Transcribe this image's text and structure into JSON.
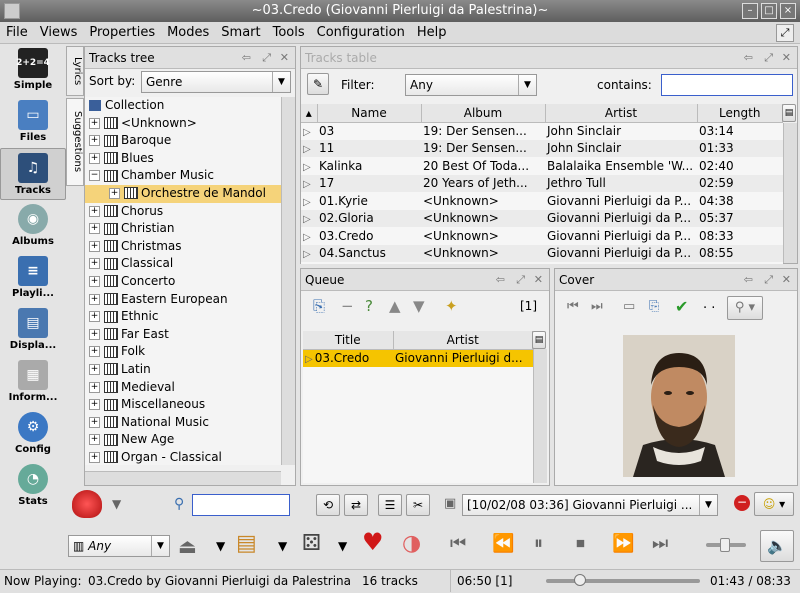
{
  "window": {
    "title": "~03.Credo (Giovanni Pierluigi da Palestrina)~"
  },
  "menu": [
    "File",
    "Views",
    "Properties",
    "Modes",
    "Smart",
    "Tools",
    "Configuration",
    "Help"
  ],
  "nav": [
    {
      "label": "Simple",
      "icon": "simple-mode-icon"
    },
    {
      "label": "Files",
      "icon": "folder-icon"
    },
    {
      "label": "Tracks",
      "icon": "music-note-icon"
    },
    {
      "label": "Albums",
      "icon": "cd-icon"
    },
    {
      "label": "Playli...",
      "icon": "playlist-icon"
    },
    {
      "label": "Displa...",
      "icon": "display-icon"
    },
    {
      "label": "Inform...",
      "icon": "info-icon"
    },
    {
      "label": "Config",
      "icon": "gear-icon"
    },
    {
      "label": "Stats",
      "icon": "pie-chart-icon"
    }
  ],
  "vtabs": [
    "Lyrics",
    "Suggestions"
  ],
  "tracks_tree": {
    "title": "Tracks tree",
    "sort_label": "Sort by:",
    "sort_value": "Genre",
    "root": "Collection",
    "items": [
      {
        "label": "<Unknown>",
        "sign": "+"
      },
      {
        "label": "Baroque",
        "sign": "+"
      },
      {
        "label": "Blues",
        "sign": "+"
      },
      {
        "label": "Chamber Music",
        "sign": "−"
      },
      {
        "label": "Orchestre de Mandol",
        "sign": "+",
        "child": true,
        "selected": true
      },
      {
        "label": "Chorus",
        "sign": "+"
      },
      {
        "label": "Christian",
        "sign": "+"
      },
      {
        "label": "Christmas",
        "sign": "+"
      },
      {
        "label": "Classical",
        "sign": "+"
      },
      {
        "label": "Concerto",
        "sign": "+"
      },
      {
        "label": "Eastern European",
        "sign": "+"
      },
      {
        "label": "Ethnic",
        "sign": "+"
      },
      {
        "label": "Far East",
        "sign": "+"
      },
      {
        "label": "Folk",
        "sign": "+"
      },
      {
        "label": "Latin",
        "sign": "+"
      },
      {
        "label": "Medieval",
        "sign": "+"
      },
      {
        "label": "Miscellaneous",
        "sign": "+"
      },
      {
        "label": "National Music",
        "sign": "+"
      },
      {
        "label": "New Age",
        "sign": "+"
      },
      {
        "label": "Organ - Classical",
        "sign": "+"
      }
    ]
  },
  "tracks_table": {
    "title": "Tracks table",
    "filter_label": "Filter:",
    "filter_value": "Any",
    "contains_label": "contains:",
    "contains_value": "",
    "columns": [
      "Name",
      "Album",
      "Artist",
      "Length"
    ],
    "rows": [
      [
        "03",
        "19: Der Sensen...",
        "John Sinclair",
        "03:14"
      ],
      [
        "11",
        "19: Der Sensen...",
        "John Sinclair",
        "01:33"
      ],
      [
        "Kalinka",
        "20 Best Of Toda...",
        "Balalaika Ensemble 'W...",
        "02:40"
      ],
      [
        "17",
        "20 Years of Jeth...",
        "Jethro Tull",
        "02:59"
      ],
      [
        "01.Kyrie",
        "<Unknown>",
        "Giovanni Pierluigi da P...",
        "04:38"
      ],
      [
        "02.Gloria",
        "<Unknown>",
        "Giovanni Pierluigi da P...",
        "05:37"
      ],
      [
        "03.Credo",
        "<Unknown>",
        "Giovanni Pierluigi da P...",
        "08:33"
      ],
      [
        "04.Sanctus",
        "<Unknown>",
        "Giovanni Pierluigi da P...",
        "08:55"
      ]
    ]
  },
  "queue": {
    "title": "Queue",
    "count": "[1]",
    "columns": [
      "Title",
      "Artist"
    ],
    "rows": [
      [
        "03.Credo",
        "Giovanni Pierluigi d..."
      ]
    ]
  },
  "cover": {
    "title": "Cover",
    "dots": ". ."
  },
  "toolbar": {
    "search_value": "",
    "history_value": "[10/02/08 03:36] Giovanni Pierluigi ...",
    "filter_any": "Any"
  },
  "status": {
    "now_playing_label": "Now Playing:",
    "now_playing": "03.Credo by Giovanni Pierluigi da Palestrina",
    "tracks": "16 tracks",
    "queue_time": "06:50 [1]",
    "position": "01:43 / 08:33",
    "progress_fraction": 0.2
  },
  "colors": {
    "selection": "#f5d37a",
    "titlebar": "#6e6e6e",
    "accent": "#3a5f9a"
  }
}
